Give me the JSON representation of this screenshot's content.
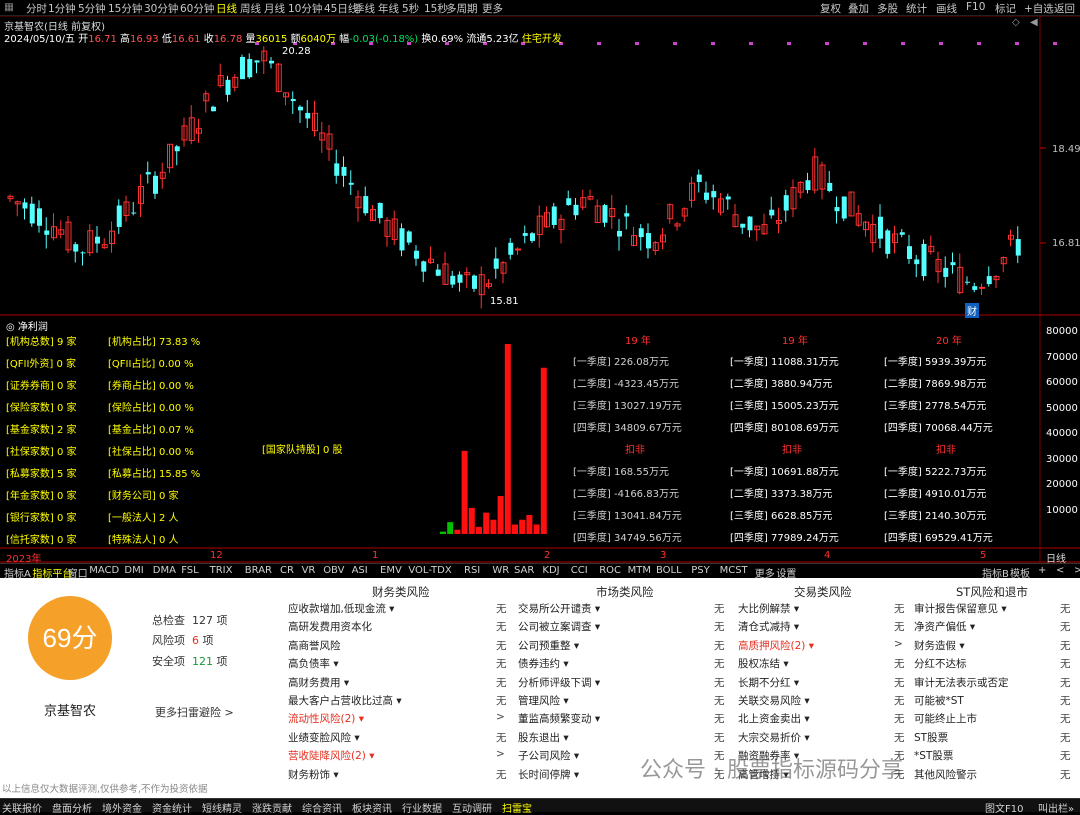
{
  "topbar": {
    "periods": [
      "分时",
      "1分钟",
      "5分钟",
      "15分钟",
      "30分钟",
      "60分钟",
      "日线",
      "周线",
      "月线",
      "10分钟",
      "45日线",
      "季线",
      "年线",
      "5秒",
      "15秒",
      "多周期",
      "更多"
    ],
    "active_period": "日线",
    "right_items": [
      "复权",
      "叠加",
      "多股",
      "统计",
      "画线",
      "F10",
      "标记",
      "+自选",
      "返回"
    ]
  },
  "stock": {
    "title_line": "京基智农(日线 前复权)",
    "date": "2024/05/10/五",
    "open_label": "开",
    "open": "16.71",
    "high_label": "高",
    "high": "16.93",
    "low_label": "低",
    "low": "16.61",
    "close_label": "收",
    "close": "16.78",
    "vol_label": "量",
    "vol": "36015",
    "amt_label": "额",
    "amt": "6040万",
    "chg_label": "幅",
    "chg": "-0.03(-0.18%)",
    "turnover_label": "换",
    "turnover": "0.69%",
    "float_label": "流通",
    "float": "5.23亿",
    "sector": "住宅开发"
  },
  "price_axis": [
    "18.49",
    "16.81"
  ],
  "annotations": {
    "high": "20.28",
    "low": "15.81",
    "tag": "财"
  },
  "indicator": {
    "name": "净利润",
    "left_rows": [
      {
        "k": "[机构总数]",
        "v": "9 家",
        "k2": "[机构占比]",
        "v2": "73.83 %"
      },
      {
        "k": "[QFII外资]",
        "v": "0 家",
        "k2": "[QFII占比]",
        "v2": "0.00 %"
      },
      {
        "k": "[证券券商]",
        "v": "0 家",
        "k2": "[券商占比]",
        "v2": "0.00 %"
      },
      {
        "k": "[保险家数]",
        "v": "0 家",
        "k2": "[保险占比]",
        "v2": "0.00 %"
      },
      {
        "k": "[基金家数]",
        "v": "2 家",
        "k2": "[基金占比]",
        "v2": "0.07 %"
      },
      {
        "k": "[社保家数]",
        "v": "0 家",
        "k2": "[社保占比]",
        "v2": "0.00 %"
      },
      {
        "k": "[私募家数]",
        "v": "5 家",
        "k2": "[私募占比]",
        "v2": "15.85 %"
      },
      {
        "k": "[年金家数]",
        "v": "0 家",
        "k2": "[财务公司]",
        "v2": "0 家"
      },
      {
        "k": "[银行家数]",
        "v": "0 家",
        "k2": "[一般法人]",
        "v2": "2 人"
      },
      {
        "k": "[信托家数]",
        "v": "0 家",
        "k2": "[特殊法人]",
        "v2": "0 人"
      }
    ],
    "national_team": "[国家队持股] 0 股",
    "years": [
      "19 年",
      "19 年",
      "20 年"
    ],
    "koufei": [
      "扣非",
      "扣非",
      "扣非"
    ],
    "col1": [
      "[一季度] 226.08万元",
      "[二季度] -4323.45万元",
      "[三季度] 13027.19万元",
      "[四季度] 34809.67万元",
      "[一季度] 168.55万元",
      "[二季度] -4166.83万元",
      "[三季度] 13041.84万元",
      "[四季度] 34749.56万元"
    ],
    "col2": [
      "[一季度] 11088.31万元",
      "[二季度] 3880.94万元",
      "[三季度] 15005.23万元",
      "[四季度] 80108.69万元",
      "[一季度] 10691.88万元",
      "[二季度] 3373.38万元",
      "[三季度] 6628.85万元",
      "[四季度] 77989.24万元"
    ],
    "col3": [
      "[一季度] 5939.39万元",
      "[二季度] 7869.98万元",
      "[三季度] 2778.54万元",
      "[四季度] 70068.44万元",
      "[一季度] 5222.73万元",
      "[二季度] 4910.01万元",
      "[三季度] 2140.30万元",
      "[四季度] 69529.41万元"
    ],
    "axis": [
      "80000",
      "70000",
      "60000",
      "50000",
      "40000",
      "30000",
      "20000",
      "10000"
    ],
    "time_axis": [
      "2023年",
      "12",
      "1",
      "2",
      "3",
      "4",
      "5"
    ],
    "period_btn": "日线",
    "bars": [
      1000,
      5000,
      1800,
      35000,
      11000,
      3000,
      9000,
      6000,
      16000,
      80000,
      4000,
      6000,
      8000,
      4000,
      70000
    ]
  },
  "indicator_tabs": [
    "指标A",
    "指标平台",
    "窗口",
    "MACD",
    "DMI",
    "DMA",
    "FSL",
    "TRIX",
    "BRAR",
    "CR",
    "VR",
    "OBV",
    "ASI",
    "EMV",
    "VOL-TDX",
    "RSI",
    "WR",
    "SAR",
    "KDJ",
    "CCI",
    "ROC",
    "MTM",
    "BOLL",
    "PSY",
    "MCST",
    "更多",
    "设置"
  ],
  "indicator_tabs_right": [
    "指标B",
    "模板",
    "+",
    "<",
    ">"
  ],
  "risk": {
    "score": "69分",
    "name": "京基智农",
    "total_label": "总检查",
    "total": "127",
    "unit": "项",
    "risk_label": "风险项",
    "risk_count": "6",
    "safe_label": "安全项",
    "safe_count": "121",
    "more": "更多扫雷避险 >",
    "headers": [
      "财务类风险",
      "市场类风险",
      "交易类风险",
      "ST风险和退市"
    ],
    "col1": [
      {
        "t": "应收款增加,低现金流 ▾",
        "v": "无"
      },
      {
        "t": "高研发费用资本化",
        "v": "无"
      },
      {
        "t": "高商誉风险",
        "v": "无"
      },
      {
        "t": "高负债率 ▾",
        "v": "无"
      },
      {
        "t": "高财务费用 ▾",
        "v": "无"
      },
      {
        "t": "最大客户占营收比过高 ▾",
        "v": "无"
      },
      {
        "t": "流动性风险(2) ▾",
        "v": ">",
        "red": true
      },
      {
        "t": "业绩变脸风险 ▾",
        "v": "无"
      },
      {
        "t": "营收陡降风险(2) ▾",
        "v": ">",
        "red": true
      },
      {
        "t": "财务粉饰 ▾",
        "v": "无"
      }
    ],
    "col2": [
      {
        "t": "交易所公开谴责 ▾",
        "v": "无"
      },
      {
        "t": "公司被立案调查 ▾",
        "v": "无"
      },
      {
        "t": "公司预重整 ▾",
        "v": "无"
      },
      {
        "t": "债券违约 ▾",
        "v": "无"
      },
      {
        "t": "分析师评级下调 ▾",
        "v": "无"
      },
      {
        "t": "管理风险 ▾",
        "v": "无"
      },
      {
        "t": "董监高频繁变动 ▾",
        "v": "无"
      },
      {
        "t": "股东退出 ▾",
        "v": "无"
      },
      {
        "t": "子公司风险 ▾",
        "v": "无"
      },
      {
        "t": "长时间停牌 ▾",
        "v": "无"
      }
    ],
    "col3": [
      {
        "t": "大比例解禁 ▾",
        "v": "无"
      },
      {
        "t": "清仓式减持 ▾",
        "v": "无"
      },
      {
        "t": "高质押风险(2) ▾",
        "v": ">",
        "red": true
      },
      {
        "t": "股权冻结 ▾",
        "v": "无"
      },
      {
        "t": "长期不分红 ▾",
        "v": "无"
      },
      {
        "t": "关联交易风险 ▾",
        "v": "无"
      },
      {
        "t": "北上资金卖出 ▾",
        "v": "无"
      },
      {
        "t": "大宗交易折价 ▾",
        "v": "无"
      },
      {
        "t": "融资融券率 ▾",
        "v": "无"
      },
      {
        "t": "高管增持 ▾",
        "v": "无"
      }
    ],
    "col4": [
      {
        "t": "审计报告保留意见 ▾",
        "v": "无"
      },
      {
        "t": "净资产偏低 ▾",
        "v": "无"
      },
      {
        "t": "财务造假 ▾",
        "v": "无"
      },
      {
        "t": "分红不达标",
        "v": "无"
      },
      {
        "t": "审计无法表示或否定",
        "v": "无"
      },
      {
        "t": "可能被*ST",
        "v": "无"
      },
      {
        "t": "可能终止上市",
        "v": "无"
      },
      {
        "t": "ST股票",
        "v": "无"
      },
      {
        "t": "*ST股票",
        "v": "无"
      },
      {
        "t": "其他风险警示",
        "v": "无"
      }
    ],
    "disclaimer": "以上信息仅大数据评测,仅供参考,不作为投资依据"
  },
  "watermark": "公众号 · 股票指标源码分享",
  "bottom_tabs": [
    "关联报价",
    "盘面分析",
    "境外资金",
    "资金统计",
    "短线精灵",
    "涨跌贡献",
    "综合资讯",
    "板块资讯",
    "行业数据",
    "互动调研",
    "扫雷宝"
  ],
  "bottom_right": [
    "图文F10",
    "叫出栏»"
  ],
  "colors": {
    "up": "#ff3030",
    "down": "#54ffff",
    "grid": "#7a0000",
    "yellow": "#ffff00",
    "score": "#f5a028"
  }
}
